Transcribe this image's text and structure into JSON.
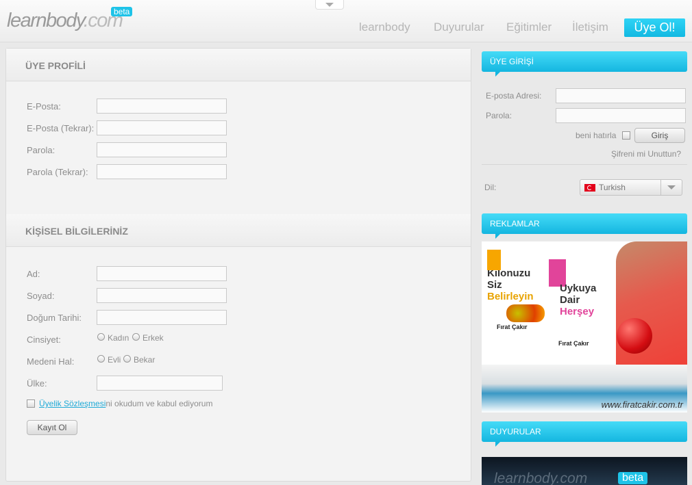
{
  "header": {
    "logo_main": "learnbody",
    "logo_tld": ".com",
    "beta": "beta",
    "nav": [
      "learnbody",
      "Duyurular",
      "Eğitimler",
      "İletişim"
    ],
    "cta": "Üye Ol!"
  },
  "profile": {
    "title": "ÜYE PROFİLİ",
    "fields": [
      "E-Posta:",
      "E-Posta (Tekrar):",
      "Parola:",
      "Parola (Tekrar):"
    ]
  },
  "personal": {
    "title": "KİŞİSEL BİLGİLERİNİZ",
    "ad": "Ad:",
    "soyad": "Soyad:",
    "dogum": "Doğum Tarihi:",
    "cinsiyet": "Cinsiyet:",
    "kadin": "Kadın",
    "erkek": "Erkek",
    "medeni": "Medeni Hal:",
    "evli": "Evli",
    "bekar": "Bekar",
    "ulke": "Ülke:",
    "agreement_link": "Üyelik Sözleşmesi",
    "agreement_rest": "ni okudum ve kabul ediyorum",
    "submit": "Kayıt Ol"
  },
  "login": {
    "title": "ÜYE GİRİŞİ",
    "email": "E-posta Adresi:",
    "password": "Parola:",
    "remember": "beni hatırla",
    "submit": "Giriş",
    "forgot": "Şifreni mi Unuttun?",
    "lang_label": "Dil:",
    "lang_value": "Turkish"
  },
  "ads": {
    "title": "REKLAMLAR",
    "book1": [
      "Kilonuzu",
      "Siz",
      "Belirleyin"
    ],
    "book2": [
      "Uykuya",
      "Dair",
      "Herşey"
    ],
    "author": "Fırat Çakır",
    "url": "www.firatcakir.com.tr"
  },
  "news": {
    "title": "DUYURULAR",
    "logo": "learnbody.com",
    "beta": "beta"
  }
}
